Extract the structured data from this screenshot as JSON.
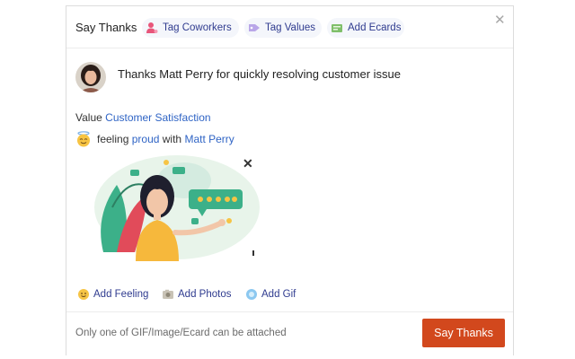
{
  "dialog": {
    "title": "Say Thanks",
    "chips": [
      {
        "label": "Tag Coworkers",
        "icon": "tag-coworkers-icon"
      },
      {
        "label": "Tag Values",
        "icon": "tag-values-icon"
      },
      {
        "label": "Add Ecards",
        "icon": "ecard-icon"
      }
    ],
    "close_glyph": "✕"
  },
  "post": {
    "message": "Thanks Matt Perry for quickly resolving customer issue",
    "value_prefix": "Value",
    "value_name": "Customer Satisfaction",
    "feeling_word": "feeling",
    "feeling_value": "proud",
    "with_word": "with",
    "with_person": "Matt Perry",
    "attachment_close_glyph": "✕"
  },
  "actions": [
    {
      "label": "Add Feeling",
      "icon": "feeling-icon"
    },
    {
      "label": "Add Photos",
      "icon": "photos-icon"
    },
    {
      "label": "Add Gif",
      "icon": "gif-icon"
    }
  ],
  "footer": {
    "hint": "Only one of GIF/Image/Ecard can be attached",
    "submit_label": "Say Thanks"
  },
  "colors": {
    "accent": "#d2481d",
    "link": "#2f64c5",
    "chip_text": "#2f3b8f",
    "chip_bg": "#f4f6fb"
  }
}
